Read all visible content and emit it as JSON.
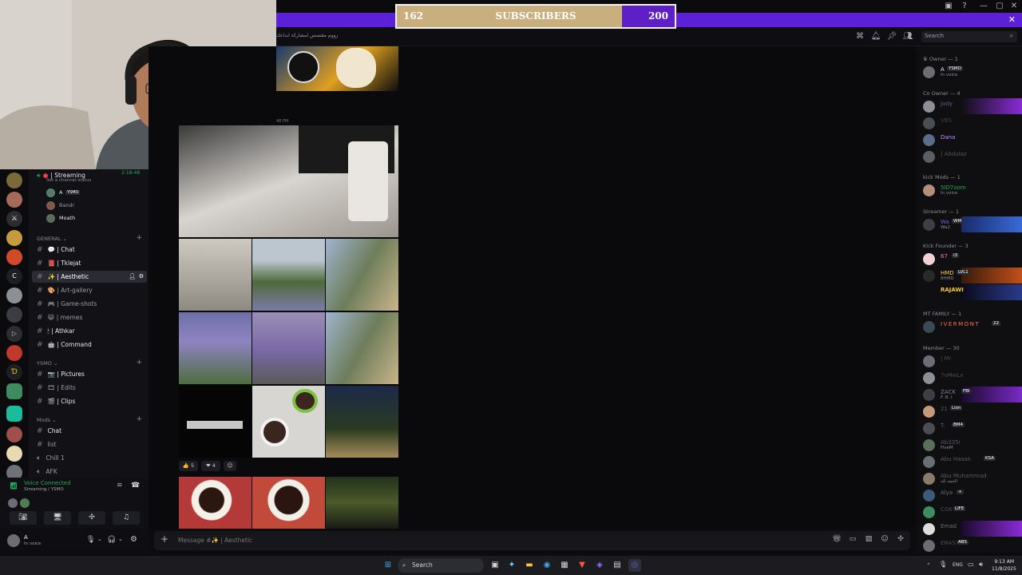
{
  "subscriber_bar": {
    "current": "162",
    "label": "SUBSCRIBERS",
    "goal": "200",
    "progress": 0.81
  },
  "header": {
    "notice": "زووم مقتصس لمشاركة ابداعك",
    "search_placeholder": "Search",
    "icons": [
      "threads-icon",
      "bell-icon",
      "pin-icon",
      "members-icon"
    ]
  },
  "voice_channel": {
    "name": "| Streaming",
    "timer": "2:18:48",
    "status_prompt": "Set a channel status",
    "users": [
      {
        "name": "A",
        "tag": "YSMO"
      },
      {
        "name": "Bandr"
      },
      {
        "name": "Moath"
      }
    ]
  },
  "categories": {
    "general": "GENERAL",
    "ysmo": "YSMO",
    "mods": "Mods"
  },
  "channels_general": [
    {
      "label": "| Chat",
      "emoji": "💬"
    },
    {
      "label": "| Tklejat",
      "emoji": "📕"
    },
    {
      "label": "| Aesthetic",
      "emoji": "✨",
      "active": true
    },
    {
      "label": "| Art-gallery",
      "emoji": "🎨"
    },
    {
      "label": "| Game-shots",
      "emoji": "🎮"
    },
    {
      "label": "| memes",
      "emoji": "😹"
    },
    {
      "label": "| Athkar",
      "emoji": "🕯"
    },
    {
      "label": "| Command",
      "emoji": "🤖"
    }
  ],
  "channels_ysmo": [
    {
      "label": "| Pictures",
      "emoji": "📷"
    },
    {
      "label": "| Edits",
      "emoji": "🎞"
    },
    {
      "label": "| Clips",
      "emoji": "🎬"
    }
  ],
  "channels_mods": [
    {
      "label": "Chat"
    },
    {
      "label": "list"
    },
    {
      "label": "Chill 1"
    },
    {
      "label": "AFK"
    }
  ],
  "voice_panel": {
    "status": "Voice Connected",
    "location": "Streaming / YSMO"
  },
  "user_panel": {
    "name": "A",
    "status": "In voice"
  },
  "chat": {
    "timestamp": "48 PM",
    "reactions": [
      {
        "emoji": "👍",
        "count": "5"
      },
      {
        "emoji": "❤",
        "count": "4"
      }
    ],
    "composer_placeholder": "Message #✨ | Aesthetic"
  },
  "members": {
    "groups": [
      {
        "title": "Owner — 1",
        "members": [
          {
            "name": "A",
            "tag": "YSMO",
            "status": "In voice"
          }
        ]
      },
      {
        "title": "Co Owner — 4",
        "members": [
          {
            "name": "Jody"
          },
          {
            "name": "VBS"
          },
          {
            "name": "Dana"
          },
          {
            "name": "| Abdulaz"
          }
        ]
      },
      {
        "title": "kick Mods — 1",
        "members": [
          {
            "name": "5ID7oom",
            "status": "In voice"
          }
        ]
      },
      {
        "title": "Streamer — 1",
        "members": [
          {
            "name": "Wa",
            "tag": "WM",
            "status": "Wa2"
          }
        ]
      },
      {
        "title": "Kick Founder — 3",
        "members": [
          {
            "name": "67",
            "tag": "i3"
          },
          {
            "name": "HMD",
            "tag": "LVL1",
            "status": "8HMD"
          },
          {
            "name": "RAJAWI"
          }
        ]
      },
      {
        "title": "MT FAMILY — 1",
        "members": [
          {
            "name": "IVERMONT",
            "tag": "22"
          }
        ]
      },
      {
        "title": "Member — 30",
        "members": [
          {
            "name": "| Mr"
          },
          {
            "name": "7vMwLx"
          },
          {
            "name": "ZACK",
            "tag": "FBI",
            "status": "F. B. I"
          },
          {
            "name": "21",
            "tag": "Lion"
          },
          {
            "name": "T.",
            "tag": "BM4"
          },
          {
            "name": "Ab335i",
            "status": "FiveM"
          },
          {
            "name": "Abu Hasan",
            "tag": "KSA"
          },
          {
            "name": "Abu Muhammad",
            "status": "الحمد لله"
          },
          {
            "name": "Alya",
            "tag": "+"
          },
          {
            "name": "CGK",
            "tag": "LIFE"
          },
          {
            "name": "Emad"
          },
          {
            "name": "ENAS",
            "tag": "ABS"
          }
        ]
      }
    ]
  },
  "taskbar": {
    "search": "Search",
    "lang": "ENG",
    "time": "9:13 AM",
    "date": "11/8/2025"
  },
  "colors": {
    "banner": "#5b20d8",
    "subbar_fill": "#c9ae7e",
    "subbar_track": "#5e1fc6",
    "online": "#23a55a",
    "dnd": "#f23f43",
    "voice_green": "#23a55a"
  }
}
